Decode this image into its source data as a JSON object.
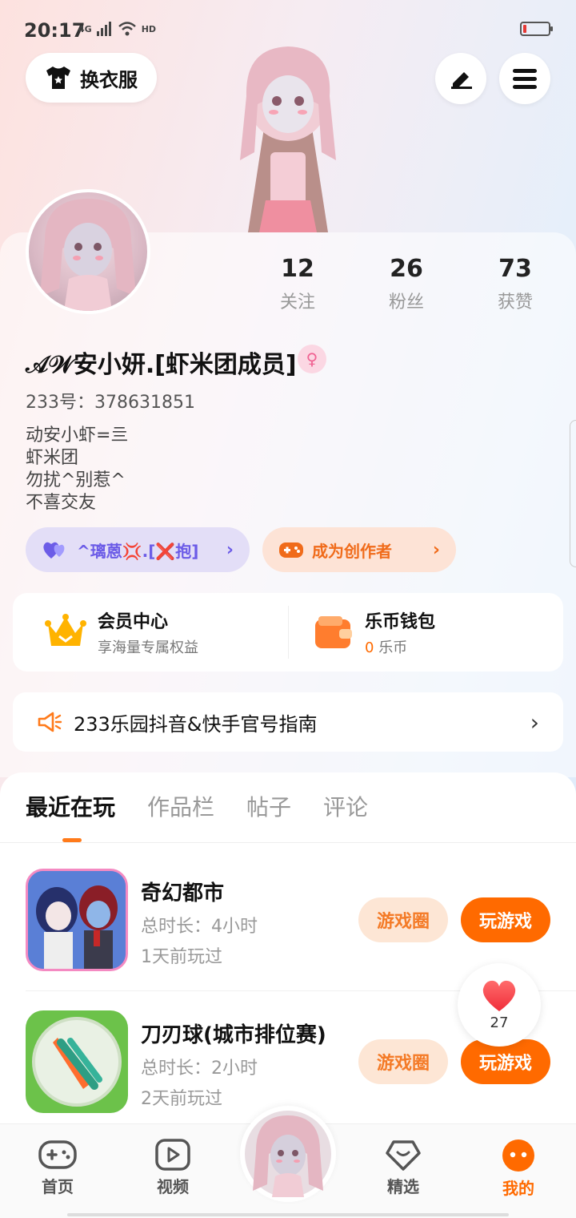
{
  "status": {
    "time": "20:17",
    "network": "4G",
    "hd": "HD"
  },
  "header": {
    "outfit_label": "换衣服"
  },
  "stats": [
    {
      "value": "12",
      "label": "关注"
    },
    {
      "value": "26",
      "label": "粉丝"
    },
    {
      "value": "73",
      "label": "获赞"
    }
  ],
  "profile": {
    "nickname": "𝒜𝒲安小妍.[虾米团成员]",
    "uid": "233号：378631851",
    "bio": [
      "动安小虾=亖",
      "虾米团",
      "勿扰^别惹^",
      "不喜交友"
    ]
  },
  "pills": {
    "family_label": "^璃蒽💢.[❌抱]",
    "creator_label": "成为创作者"
  },
  "wallet": {
    "vip_title": "会员中心",
    "vip_sub": "享海量专属权益",
    "coin_title": "乐币钱包",
    "coin_amount": "0",
    "coin_unit": "乐币"
  },
  "notice": {
    "text": "233乐园抖音&快手官号指南"
  },
  "tabs": [
    "最近在玩",
    "作品栏",
    "帖子",
    "评论"
  ],
  "games": [
    {
      "name": "奇幻都市",
      "duration": "总时长：4小时",
      "last_played": "1天前玩过",
      "circle_label": "游戏圈",
      "play_label": "玩游戏"
    },
    {
      "name": "刀刃球(城市排位赛)",
      "duration": "总时长：2小时",
      "last_played": "2天前玩过",
      "circle_label": "游戏圈",
      "play_label": "玩游戏"
    }
  ],
  "like": {
    "count": "27"
  },
  "nav": {
    "items": [
      {
        "label": "首页"
      },
      {
        "label": "视频"
      },
      {
        "label": "精选"
      },
      {
        "label": "我的"
      }
    ]
  },
  "colors": {
    "accent": "#ff6a00",
    "family_bg": "#e3def7",
    "creator_bg": "#fde3d6"
  }
}
